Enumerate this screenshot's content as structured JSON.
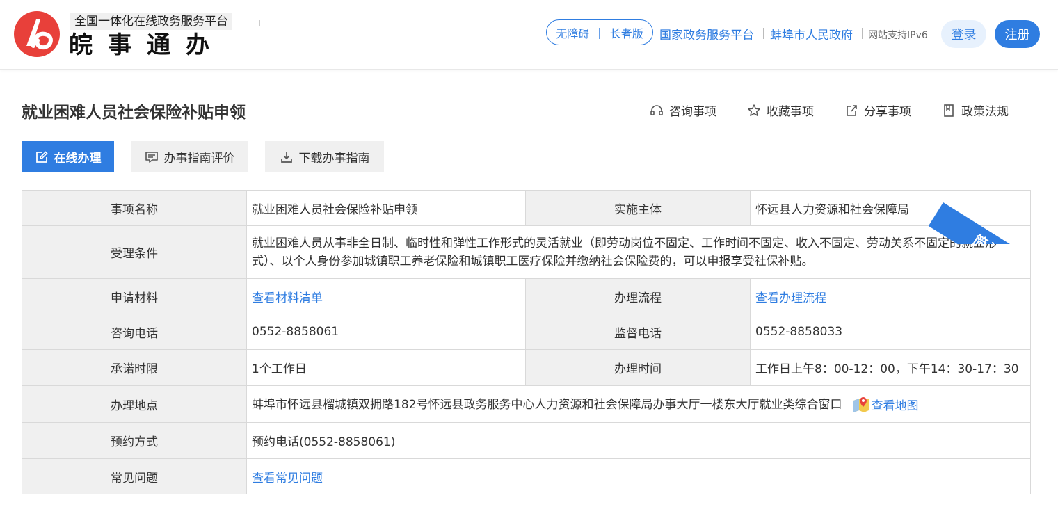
{
  "header": {
    "logo_subtitle": "全国一体化在线政务服务平台",
    "logo_title": "皖事通办",
    "accessibility": {
      "barrier_free": "无障碍",
      "elder": "长者版"
    },
    "links": [
      "国家政务服务平台",
      "蚌埠市人民政府"
    ],
    "ipv6": "网站支持IPv6",
    "login": "登录",
    "register": "注册",
    "brand_color": "#2f7de1"
  },
  "page": {
    "title": "就业困难人员社会保险补贴申领",
    "actions": [
      {
        "label": "咨询事项",
        "icon": "headset-icon"
      },
      {
        "label": "收藏事项",
        "icon": "star-icon"
      },
      {
        "label": "分享事项",
        "icon": "share-icon"
      },
      {
        "label": "政策法规",
        "icon": "document-icon"
      }
    ],
    "tabs": [
      {
        "label": "在线办理",
        "icon": "edit-icon"
      },
      {
        "label": "办事指南评价",
        "icon": "comment-icon"
      },
      {
        "label": "下载办事指南",
        "icon": "download-icon"
      }
    ]
  },
  "ribbon": "简洁版",
  "table": {
    "item_name_label": "事项名称",
    "item_name": "就业困难人员社会保险补贴申领",
    "agency_label": "实施主体",
    "agency": "怀远县人力资源和社会保障局",
    "conditions_label": "受理条件",
    "conditions": "就业困难人员从事非全日制、临时性和弹性工作形式的灵活就业（即劳动岗位不固定、工作时间不固定、收入不固定、劳动关系不固定的就业形式）、以个人身份参加城镇职工养老保险和城镇职工医疗保险并缴纳社会保险费的，可以申报享受社保补贴。",
    "materials_label": "申请材料",
    "materials_link": "查看材料清单",
    "process_label": "办理流程",
    "process_link": "查看办理流程",
    "consult_phone_label": "咨询电话",
    "consult_phone": "0552-8858061",
    "supervise_phone_label": "监督电话",
    "supervise_phone": "0552-8858033",
    "time_limit_label": "承诺时限",
    "time_limit": "1个工作日",
    "office_hours_label": "办理时间",
    "office_hours": "工作日上午8：00-12：00，下午14：30-17：30",
    "location_label": "办理地点",
    "location": "蚌埠市怀远县榴城镇双拥路182号怀远县政务服务中心人力资源和社会保障局办事大厅一楼东大厅就业类综合窗口",
    "map_link": "查看地图",
    "appointment_label": "预约方式",
    "appointment": "预约电话(0552-8858061)",
    "faq_label": "常见问题",
    "faq_link": "查看常见问题"
  }
}
